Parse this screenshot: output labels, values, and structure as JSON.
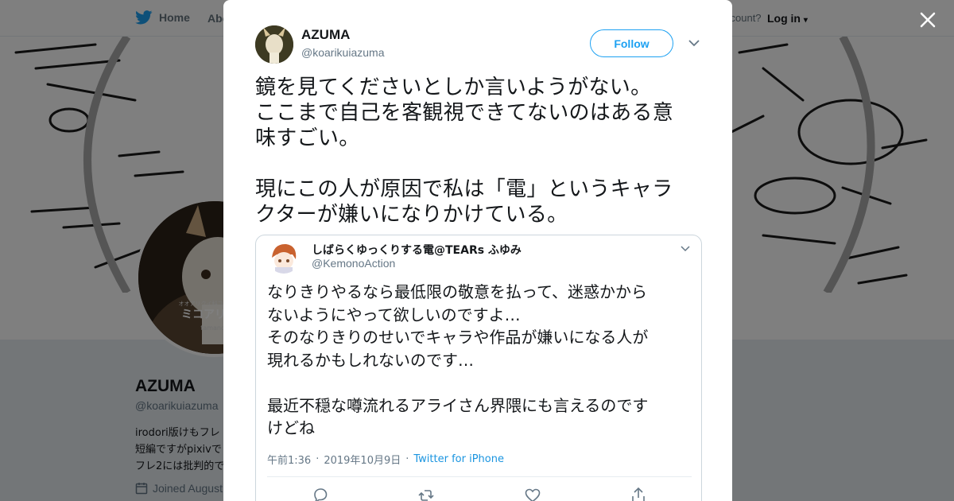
{
  "nav": {
    "home_label": "Home",
    "about_label": "Abo",
    "account_text": "ccount?",
    "login_label": "Log in"
  },
  "background_profile": {
    "avatar_caption": "ミコアリクイ",
    "avatar_caption_small": "tamanoa",
    "avatar_caption_top": "オオアリクイ科コアリクイ属",
    "name": "AZUMA",
    "handle": "@koarikuiazuma",
    "bio_lines": [
      "irodori版けもフレ",
      "短編ですがpixivで",
      "フレ2には批判的で"
    ],
    "joined": "Joined August"
  },
  "tweet": {
    "author_name": "AZUMA",
    "author_handle": "@koarikuiazuma",
    "follow_label": "Follow",
    "text": "鏡を見てくださいとしか言いようがない。\nここまで自己を客観視できてないのはある意\n味すごい。\n\n現にこの人が原因で私は「電」というキャラ\nクターが嫌いになりかけている。"
  },
  "quoted_tweet": {
    "author_name": "しばらくゆっくりする電@TEARs ふゆみ",
    "author_handle": "@KemonoAction",
    "text": "なりきりやるなら最低限の敬意を払って、迷惑かから\nないようにやって欲しいのですよ…\nそのなりきりのせいでキャラや作品が嫌いになる人が\n現れるかもしれないのです…\n\n最近不穏な噂流れるアライさん界隈にも言えるのです\nけどね",
    "time": "午前1:36",
    "date": "2019年10月9日",
    "source": "Twitter for iPhone"
  },
  "colors": {
    "accent": "#1da1f2",
    "link": "#1b95e0",
    "secondary_text": "#657786",
    "overlay": "rgba(0,0,0,0.5)"
  },
  "icons": [
    "twitter-bird-icon",
    "close-icon",
    "chevron-down-icon",
    "calendar-icon",
    "reply-icon",
    "retweet-icon",
    "like-icon",
    "share-icon"
  ]
}
